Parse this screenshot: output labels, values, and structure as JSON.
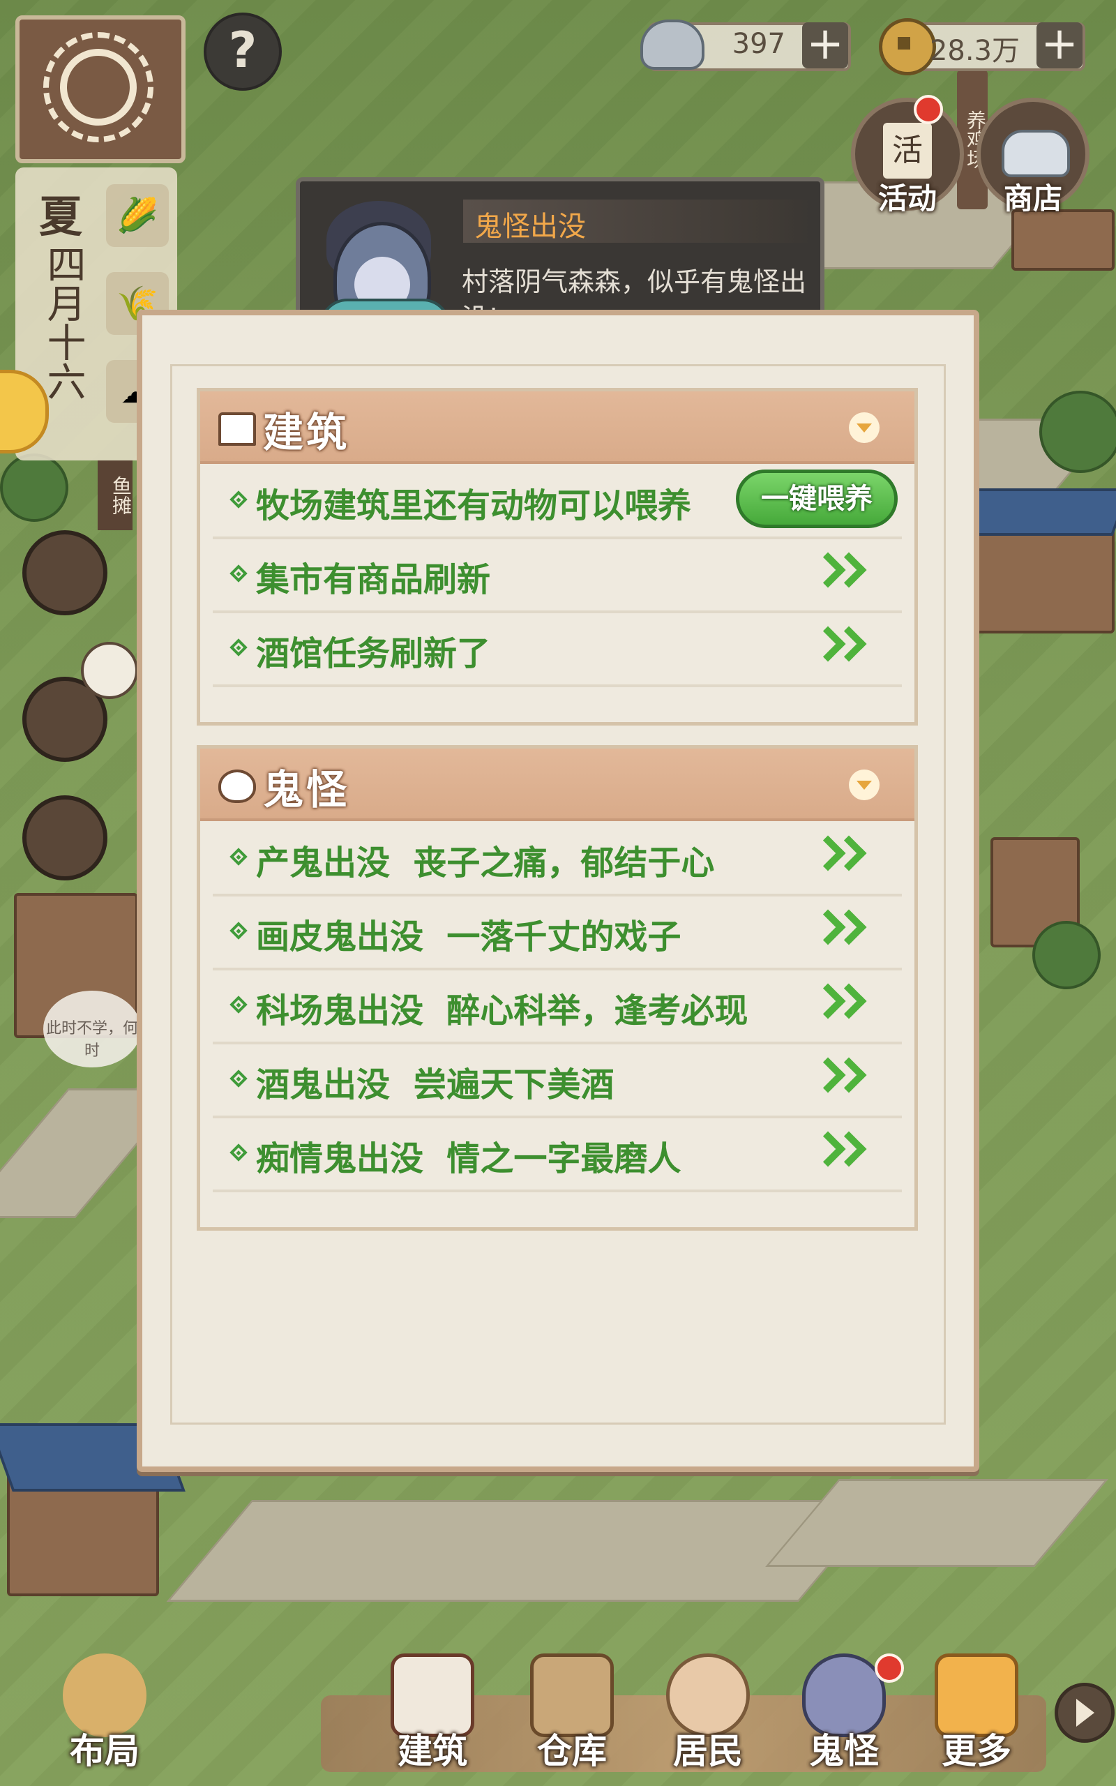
{
  "hud": {
    "season": "夏",
    "date": "四月十六",
    "silver": "397",
    "coins": "28.3万",
    "help_symbol": "?",
    "plus_symbol": "+",
    "activity_label": "活动",
    "shop_label": "商店",
    "chicken_farm_sign": "养鸡场",
    "fish_stall_sign": "鱼摊",
    "speech_bubble": "此时不学，何时"
  },
  "notification": {
    "title": "鬼怪出没",
    "text": "村落阴气森森，似乎有鬼怪出没!"
  },
  "panel": {
    "sections": [
      {
        "title": "建筑",
        "icon": "house-icon",
        "rows": [
          {
            "text": "牧场建筑里还有动物可以喂养",
            "action": "一键喂养"
          },
          {
            "text": "集市有商品刷新"
          },
          {
            "text": "酒馆任务刷新了"
          }
        ]
      },
      {
        "title": "鬼怪",
        "icon": "ghost-icon",
        "rows": [
          {
            "text": "产鬼出没  丧子之痛，郁结于心"
          },
          {
            "text": "画皮鬼出没  一落千丈的戏子"
          },
          {
            "text": "科场鬼出没  醉心科举，逢考必现"
          },
          {
            "text": "酒鬼出没  尝遍天下美酒"
          },
          {
            "text": "痴情鬼出没  情之一字最磨人"
          }
        ]
      }
    ]
  },
  "bottom_nav": {
    "layout": "布局",
    "build": "建筑",
    "storage": "仓库",
    "residents": "居民",
    "ghosts": "鬼怪",
    "more": "更多"
  },
  "colors": {
    "accent_green": "#3d8f2f",
    "section_header": "#d9ab8a",
    "notification_title": "#f2a84a",
    "badge_red": "#e03a2e"
  }
}
